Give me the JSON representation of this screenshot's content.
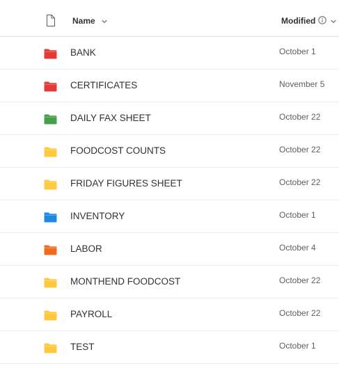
{
  "header": {
    "name_label": "Name",
    "modified_label": "Modified",
    "icons": {
      "file_type": "document-icon",
      "name_sort": "chevron-down-icon",
      "info": "info-icon",
      "modified_sort": "chevron-down-icon"
    }
  },
  "colors": {
    "red": "#e53935",
    "green": "#43a047",
    "yellow": "#ffc83d",
    "blue": "#1e88e5",
    "orange": "#f26b1d",
    "divider": "#edebe9",
    "text": "#323130",
    "date_text": "#605e5c"
  },
  "rows": [
    {
      "name": "BANK",
      "modified": "October 1",
      "icon": "folder-icon",
      "color": "red"
    },
    {
      "name": "CERTIFICATES",
      "modified": "November 5",
      "icon": "folder-icon",
      "color": "red"
    },
    {
      "name": "DAILY FAX SHEET",
      "modified": "October 22",
      "icon": "folder-icon",
      "color": "green"
    },
    {
      "name": "FOODCOST COUNTS",
      "modified": "October 22",
      "icon": "folder-icon",
      "color": "yellow"
    },
    {
      "name": "FRIDAY FIGURES SHEET",
      "modified": "October 22",
      "icon": "folder-icon",
      "color": "yellow"
    },
    {
      "name": "INVENTORY",
      "modified": "October 1",
      "icon": "folder-icon",
      "color": "blue"
    },
    {
      "name": "LABOR",
      "modified": "October 4",
      "icon": "folder-icon",
      "color": "orange"
    },
    {
      "name": "MONTHEND FOODCOST",
      "modified": "October 22",
      "icon": "folder-icon",
      "color": "yellow"
    },
    {
      "name": "PAYROLL",
      "modified": "October 22",
      "icon": "folder-icon",
      "color": "yellow"
    },
    {
      "name": "TEST",
      "modified": "October 1",
      "icon": "folder-icon",
      "color": "yellow"
    }
  ]
}
